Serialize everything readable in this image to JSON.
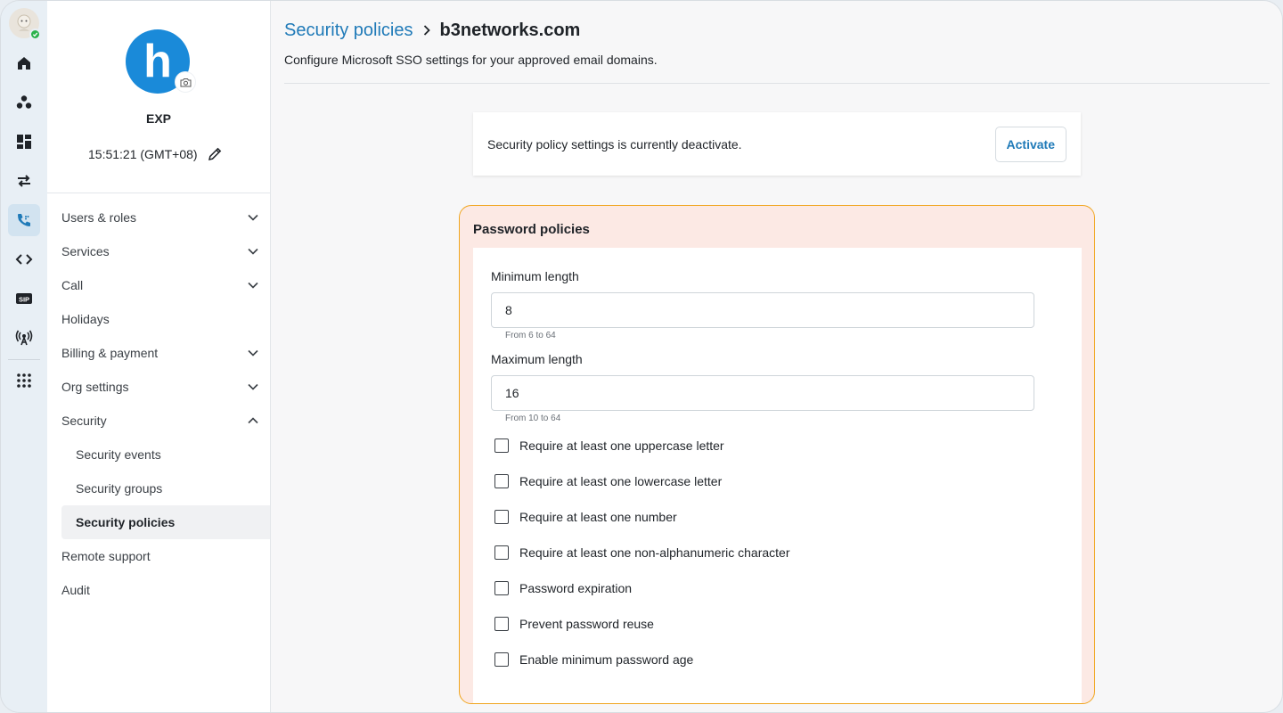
{
  "rail": {
    "items": [
      {
        "icon": "home-icon"
      },
      {
        "icon": "team-icon"
      },
      {
        "icon": "dashboard-icon"
      },
      {
        "icon": "transfer-icon"
      },
      {
        "icon": "phone-icon",
        "active": true
      },
      {
        "icon": "code-icon"
      },
      {
        "icon": "sip-icon",
        "label": "SIP"
      },
      {
        "icon": "broadcast-icon"
      },
      {
        "icon": "apps-grid-icon"
      }
    ]
  },
  "org": {
    "logo_letter": "h",
    "name": "EXP",
    "time": "15:51:21 (GMT+08)"
  },
  "sidebar": {
    "items": [
      {
        "label": "Users & roles",
        "chevron": "down"
      },
      {
        "label": "Services",
        "chevron": "down"
      },
      {
        "label": "Call",
        "chevron": "down"
      },
      {
        "label": "Holidays"
      },
      {
        "label": "Billing & payment",
        "chevron": "down"
      },
      {
        "label": "Org settings",
        "chevron": "down"
      },
      {
        "label": "Security",
        "chevron": "up"
      },
      {
        "label": "Security events",
        "sub": true
      },
      {
        "label": "Security groups",
        "sub": true
      },
      {
        "label": "Security policies",
        "sub": true,
        "selected": true
      },
      {
        "label": "Remote support"
      },
      {
        "label": "Audit"
      }
    ]
  },
  "header": {
    "breadcrumb_parent": "Security policies",
    "breadcrumb_current": "b3networks.com",
    "subtitle": "Configure Microsoft SSO settings for your approved email domains."
  },
  "status": {
    "text": "Security policy settings is currently deactivate.",
    "activate_label": "Activate"
  },
  "password_policies": {
    "title": "Password policies",
    "min_label": "Minimum length",
    "min_value": "8",
    "min_hint": "From 6 to 64",
    "max_label": "Maximum length",
    "max_value": "16",
    "max_hint": "From 10 to 64",
    "checks": [
      "Require at least one uppercase letter",
      "Require at least one lowercase letter",
      "Require at least one number",
      "Require at least one non-alphanumeric character",
      "Password expiration",
      "Prevent password reuse",
      "Enable minimum password age"
    ]
  },
  "colors": {
    "accent": "#1f7ab8",
    "logo": "#1a8ad9",
    "policy_border": "#f0a51e",
    "policy_bg": "#fce9e4",
    "online": "#2bb24c"
  }
}
